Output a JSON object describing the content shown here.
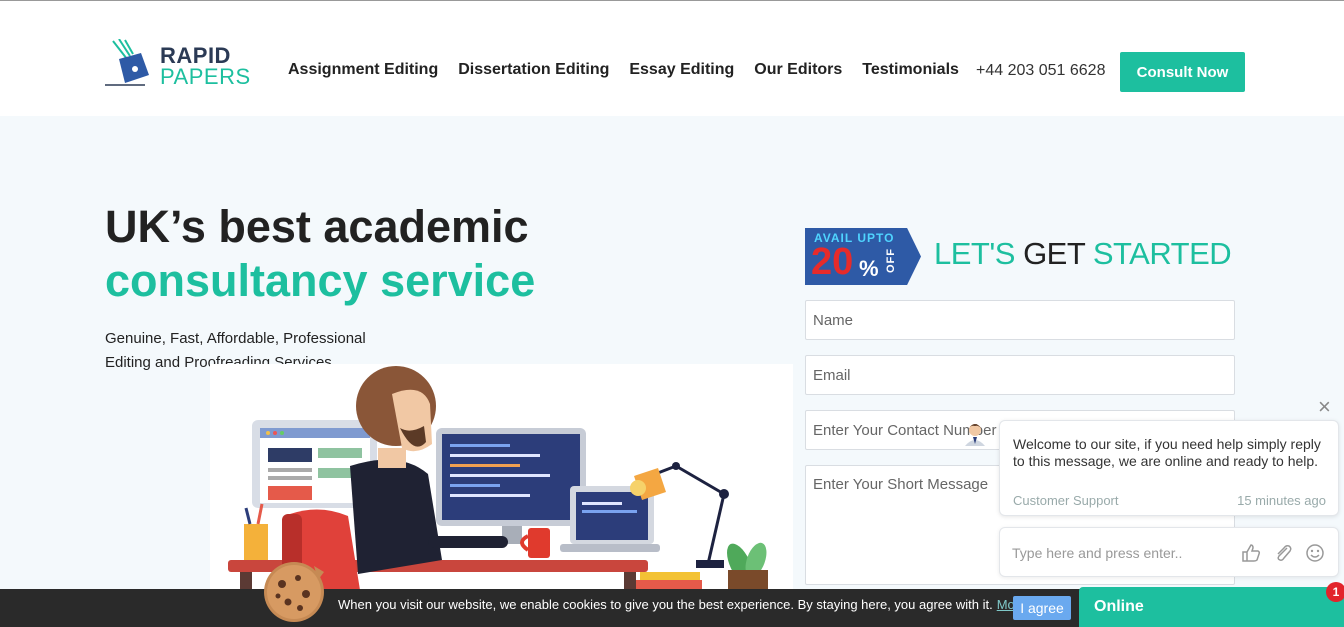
{
  "brand": {
    "line1": "RAPID",
    "line2": "PAPERS",
    "accent": "#1dbf9f",
    "dark": "#2b3a55"
  },
  "nav": {
    "items": [
      {
        "label": "Assignment Editing"
      },
      {
        "label": "Dissertation Editing"
      },
      {
        "label": "Essay Editing"
      },
      {
        "label": "Our Editors"
      },
      {
        "label": "Testimonials"
      }
    ],
    "phone": "+44 203 051 6628",
    "cta": "Consult Now"
  },
  "hero": {
    "title_line1": "UK’s best academic",
    "title_line2": "consultancy service",
    "subtitle_line1": "Genuine, Fast, Affordable, Professional",
    "subtitle_line2": "Editing and Proofreading Services"
  },
  "promo": {
    "top": "AVAIL UPTO",
    "number": "20",
    "percent": "%",
    "off": "OFF"
  },
  "form": {
    "heading_part1": "LET'S ",
    "heading_part2": "GET",
    "heading_part3": " STARTED",
    "name_placeholder": "Name",
    "email_placeholder": "Email",
    "phone_placeholder": "Enter Your Contact Number",
    "message_placeholder": "Enter Your Short Message"
  },
  "chat": {
    "close": "×",
    "message": "Welcome to our site, if you need help simply reply to this message, we are online and ready to help.",
    "from": "Customer Support",
    "time": "15 minutes ago",
    "input_placeholder": "Type here and press enter..",
    "icons": [
      "thumbs-up-icon",
      "paperclip-icon",
      "smiley-icon"
    ],
    "status": "Online",
    "badge": "1"
  },
  "cookie": {
    "text": "When you visit our website, we enable cookies to give you the best experience. By staying here, you agree with it.",
    "more": "More.",
    "agree": "I agree"
  }
}
